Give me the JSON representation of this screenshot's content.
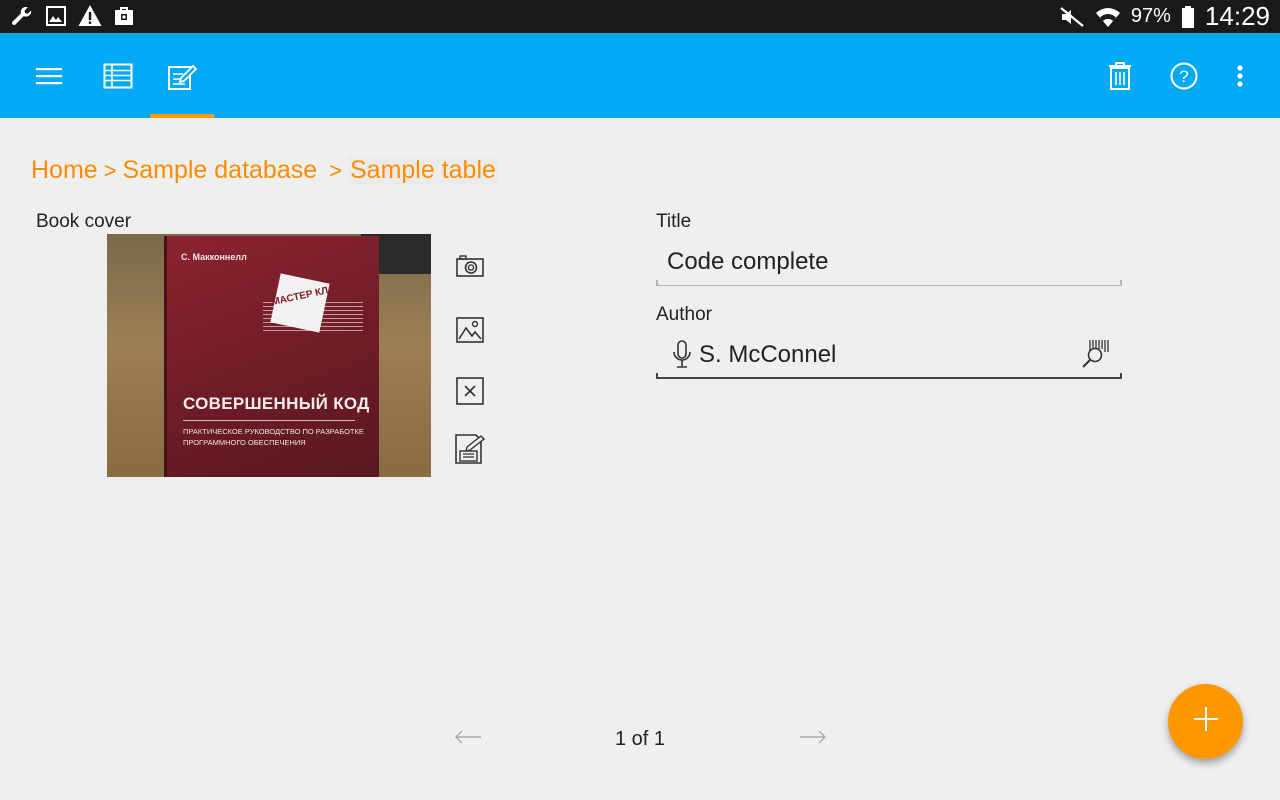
{
  "status_bar": {
    "left_icons": [
      "wrench-icon",
      "image-icon",
      "warning-icon",
      "briefcase-icon"
    ],
    "battery_percent": "97%",
    "time": "14:29"
  },
  "toolbar": {
    "color": "#03a9f4",
    "accent": "#ff9800",
    "icons": [
      "menu-icon",
      "table-view-icon",
      "edit-form-icon",
      "delete-icon",
      "help-icon",
      "overflow-menu-icon"
    ]
  },
  "breadcrumb": {
    "home": "Home",
    "separator": ">",
    "database": "Sample database",
    "table": "Sample table"
  },
  "book_cover": {
    "label": "Book cover",
    "image": {
      "author": "С. Макконнелл",
      "series": "МАСТЕР КЛАСС",
      "title": "СОВЕРШЕННЫЙ КОД",
      "subtitle_line1": "ПРАКТИЧЕСКОЕ РУКОВОДСТВО ПО РАЗРАБОТКЕ",
      "subtitle_line2": "ПРОГРАММНОГО ОБЕСПЕЧЕНИЯ"
    },
    "actions": [
      "camera-icon",
      "gallery-icon",
      "clear-image-icon",
      "save-image-icon"
    ]
  },
  "fields": {
    "title": {
      "label": "Title",
      "value": "Code complete"
    },
    "author": {
      "label": "Author",
      "value": "S. McConnel"
    }
  },
  "pager": {
    "text": "1 of 1"
  },
  "fab": {
    "icon": "add-icon",
    "color": "#ff9800"
  }
}
